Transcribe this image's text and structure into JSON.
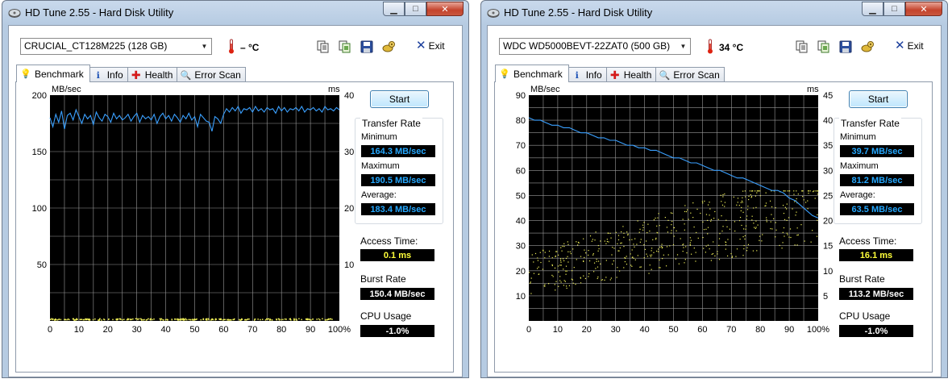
{
  "colors": {
    "transfer_line": "#3aa0ff",
    "access_dots": "#f2f25a",
    "grid": "#9a9a9a",
    "plot_bg": "#000000",
    "value_blue": "#25a8ff",
    "value_yellow": "#ffff3a"
  },
  "windows": [
    {
      "title": "HD Tune 2.55 - Hard Disk Utility",
      "drive": "CRUCIAL_CT128M225 (128 GB)",
      "temperature": "– °C",
      "exit_label": "Exit",
      "tabs": [
        {
          "label": "Benchmark",
          "icon": "benchmark-icon",
          "active": true
        },
        {
          "label": "Info",
          "icon": "info-icon",
          "active": false
        },
        {
          "label": "Health",
          "icon": "health-cross-icon",
          "active": false
        },
        {
          "label": "Error Scan",
          "icon": "magnifier-icon",
          "active": false
        }
      ],
      "toolbar_icons": [
        "copy-text-icon",
        "copy-info-icon",
        "save-icon",
        "options-icon"
      ],
      "start_label": "Start",
      "transfer_rate": {
        "title": "Transfer Rate",
        "minimum_label": "Minimum",
        "minimum": "164.3 MB/sec",
        "maximum_label": "Maximum",
        "maximum": "190.5 MB/sec",
        "average_label": "Average:",
        "average": "183.4 MB/sec"
      },
      "access_time_label": "Access Time:",
      "access_time": "0.1 ms",
      "burst_rate_label": "Burst Rate",
      "burst_rate": "150.4 MB/sec",
      "cpu_usage_label": "CPU Usage",
      "cpu_usage": "-1.0%"
    },
    {
      "title": "HD Tune 2.55 - Hard Disk Utility",
      "drive": "WDC WD5000BEVT-22ZAT0 (500 GB)",
      "temperature": "34 °C",
      "exit_label": "Exit",
      "tabs": [
        {
          "label": "Benchmark",
          "icon": "benchmark-icon",
          "active": true
        },
        {
          "label": "Info",
          "icon": "info-icon",
          "active": false
        },
        {
          "label": "Health",
          "icon": "health-cross-icon",
          "active": false
        },
        {
          "label": "Error Scan",
          "icon": "magnifier-icon",
          "active": false
        }
      ],
      "toolbar_icons": [
        "copy-text-icon",
        "copy-info-icon",
        "save-icon",
        "options-icon"
      ],
      "start_label": "Start",
      "transfer_rate": {
        "title": "Transfer Rate",
        "minimum_label": "Minimum",
        "minimum": "39.7 MB/sec",
        "maximum_label": "Maximum",
        "maximum": "81.2 MB/sec",
        "average_label": "Average:",
        "average": "63.5 MB/sec"
      },
      "access_time_label": "Access Time:",
      "access_time": "16.1 ms",
      "burst_rate_label": "Burst Rate",
      "burst_rate": "113.2 MB/sec",
      "cpu_usage_label": "CPU Usage",
      "cpu_usage": "-1.0%"
    }
  ],
  "chart_data": [
    {
      "type": "line",
      "ylabel_left": "MB/sec",
      "ylabel_right": "ms",
      "xlim": [
        0,
        100
      ],
      "ylim_left": [
        0,
        200
      ],
      "ylim_right": [
        0,
        40
      ],
      "xticks": [
        "0",
        "10",
        "20",
        "30",
        "40",
        "50",
        "60",
        "70",
        "80",
        "90",
        "100%"
      ],
      "yticks_left": [
        "50",
        "100",
        "150",
        "200"
      ],
      "yticks_right": [
        "10",
        "20",
        "30",
        "40"
      ],
      "grid": true,
      "series": [
        {
          "name": "Transfer Rate",
          "axis": "left",
          "x": [
            0,
            1,
            2,
            3,
            4,
            5,
            6,
            7,
            8,
            9,
            10,
            11,
            12,
            13,
            14,
            15,
            16,
            17,
            18,
            19,
            20,
            21,
            22,
            23,
            24,
            25,
            26,
            27,
            28,
            29,
            30,
            31,
            32,
            33,
            34,
            35,
            36,
            37,
            38,
            39,
            40,
            41,
            42,
            43,
            44,
            45,
            46,
            47,
            48,
            49,
            50,
            51,
            52,
            53,
            54,
            55,
            56,
            57,
            58,
            59,
            60,
            61,
            62,
            63,
            64,
            65,
            66,
            67,
            68,
            69,
            70,
            71,
            72,
            73,
            74,
            75,
            76,
            77,
            78,
            79,
            80,
            81,
            82,
            83,
            84,
            85,
            86,
            87,
            88,
            89,
            90,
            91,
            92,
            93,
            94,
            95,
            96,
            97,
            98,
            99,
            100
          ],
          "y": [
            180,
            172,
            183,
            176,
            186,
            170,
            182,
            184,
            178,
            187,
            181,
            175,
            183,
            179,
            182,
            174,
            185,
            180,
            177,
            183,
            181,
            176,
            184,
            179,
            182,
            178,
            180,
            183,
            177,
            181,
            184,
            176,
            182,
            179,
            181,
            178,
            183,
            175,
            181,
            184,
            179,
            182,
            177,
            183,
            180,
            176,
            182,
            179,
            184,
            178,
            181,
            172,
            183,
            180,
            177,
            176,
            168,
            181,
            179,
            175,
            183,
            188,
            185,
            189,
            186,
            190,
            184,
            188,
            187,
            189,
            185,
            190,
            186,
            188,
            185,
            189,
            187,
            188,
            184,
            190,
            186,
            189,
            185,
            188,
            187,
            189,
            186,
            190,
            185,
            188,
            187,
            189,
            186,
            188,
            185,
            190,
            187,
            188,
            186,
            189,
            187
          ]
        },
        {
          "name": "Access Time",
          "axis": "right",
          "points": "scatter clustered at ~0.1 ms along the baseline"
        }
      ]
    },
    {
      "type": "line",
      "ylabel_left": "MB/sec",
      "ylabel_right": "ms",
      "xlim": [
        0,
        100
      ],
      "ylim_left": [
        0,
        90
      ],
      "ylim_right": [
        0,
        45
      ],
      "xticks": [
        "0",
        "10",
        "20",
        "30",
        "40",
        "50",
        "60",
        "70",
        "80",
        "90",
        "100%"
      ],
      "yticks_left": [
        "10",
        "20",
        "30",
        "40",
        "50",
        "60",
        "70",
        "80",
        "90"
      ],
      "yticks_right": [
        "5",
        "10",
        "15",
        "20",
        "25",
        "30",
        "35",
        "40",
        "45"
      ],
      "grid": true,
      "series": [
        {
          "name": "Transfer Rate",
          "axis": "left",
          "x": [
            0,
            2,
            4,
            6,
            8,
            10,
            12,
            14,
            16,
            18,
            20,
            22,
            24,
            26,
            28,
            30,
            32,
            34,
            36,
            38,
            40,
            42,
            44,
            46,
            48,
            50,
            52,
            54,
            56,
            58,
            60,
            62,
            64,
            66,
            68,
            70,
            72,
            74,
            76,
            78,
            80,
            82,
            84,
            86,
            88,
            90,
            92,
            94,
            96,
            98,
            100
          ],
          "y": [
            81,
            80,
            80,
            79,
            78,
            78,
            77,
            77,
            76,
            75,
            75,
            74,
            73,
            73,
            72,
            72,
            71,
            70,
            70,
            69,
            69,
            68,
            68,
            67,
            66,
            65,
            65,
            64,
            63,
            63,
            62,
            61,
            60,
            60,
            59,
            58,
            57,
            57,
            56,
            55,
            54,
            53,
            52,
            52,
            51,
            49,
            48,
            46,
            44,
            42,
            41
          ]
        },
        {
          "name": "Access Time",
          "axis": "right",
          "points": "scatter, roughly 4–26 ms, rising with position"
        }
      ]
    }
  ]
}
